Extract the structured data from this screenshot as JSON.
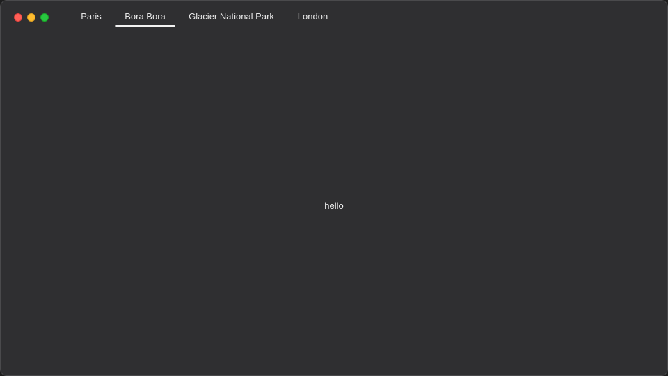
{
  "window": {
    "controls": {
      "close": "close-button",
      "minimize": "minimize-button",
      "zoom": "zoom-button"
    },
    "colors": {
      "background": "#2f2f31",
      "close": "#ff5f57",
      "minimize": "#febc2e",
      "zoom": "#28c840"
    }
  },
  "tabs": [
    {
      "label": "Paris",
      "active": false
    },
    {
      "label": "Bora Bora",
      "active": true
    },
    {
      "label": "Glacier National Park",
      "active": false
    },
    {
      "label": "London",
      "active": false
    }
  ],
  "content": {
    "text": "hello"
  }
}
